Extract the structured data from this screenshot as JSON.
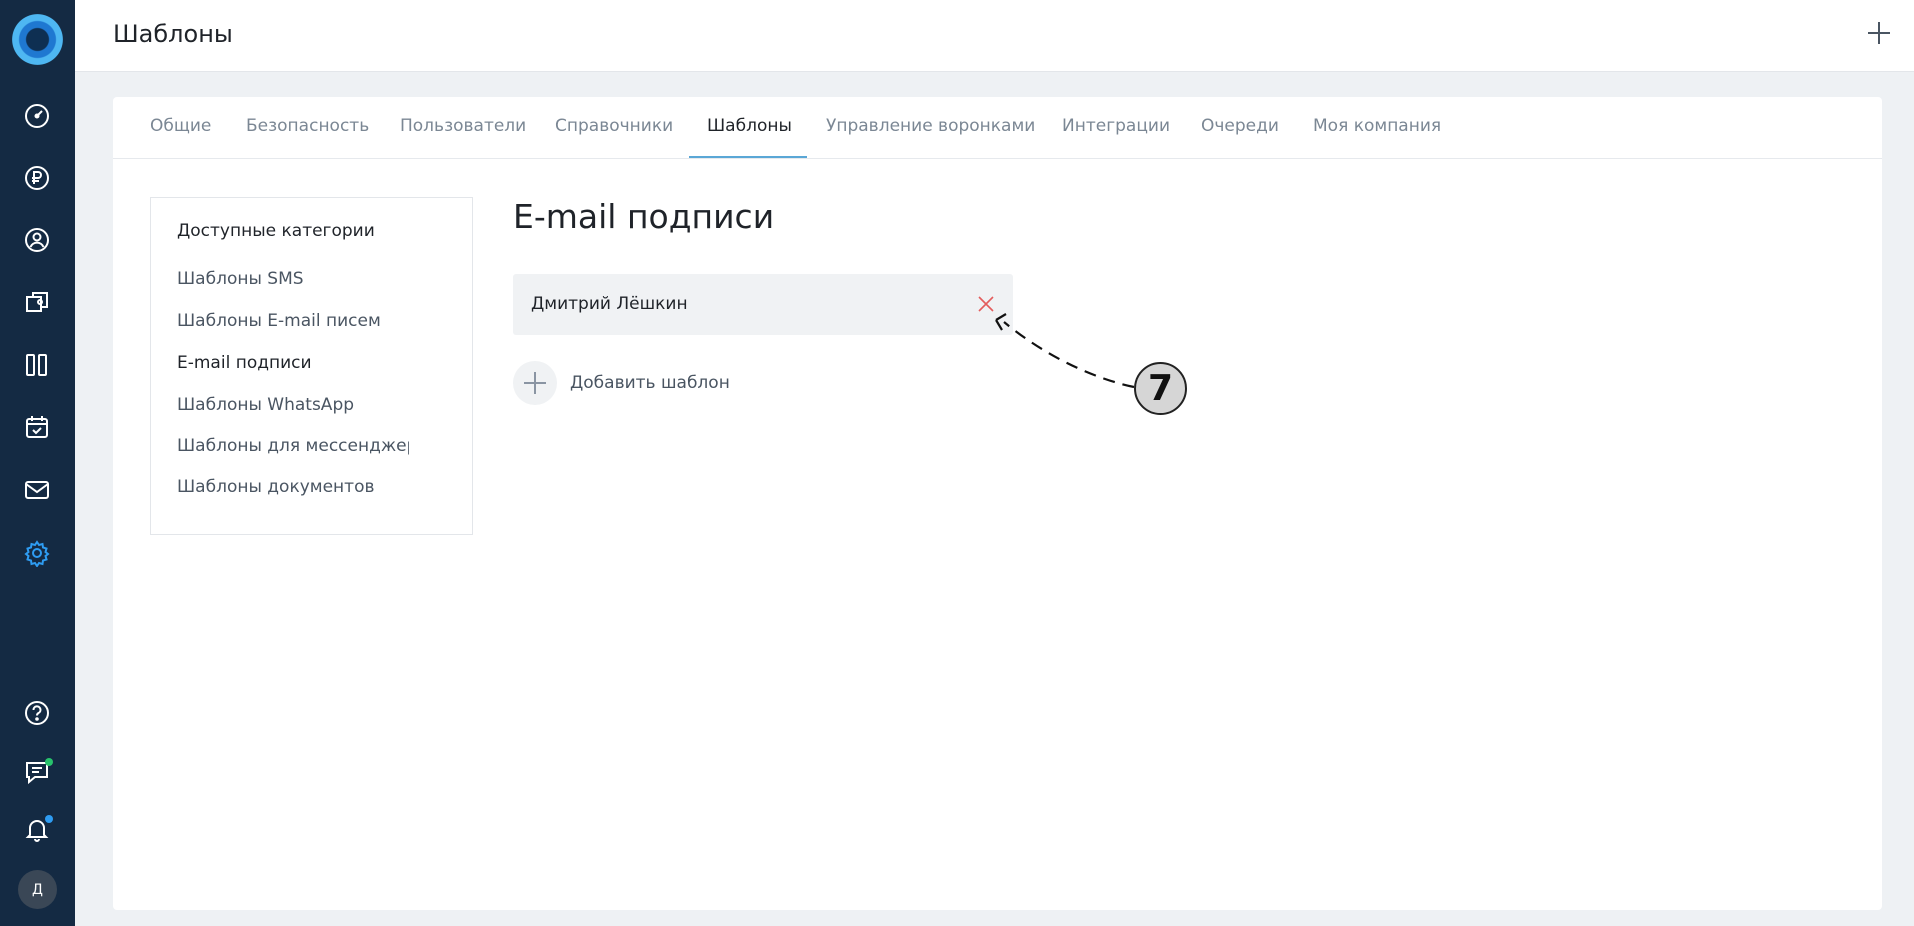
{
  "header": {
    "title": "Шаблоны",
    "add_icon": "plus-icon"
  },
  "sidebar": {
    "logo": "app-logo",
    "items": [
      {
        "icon": "dashboard-icon"
      },
      {
        "icon": "ruble-icon"
      },
      {
        "icon": "contacts-icon"
      },
      {
        "icon": "deals-icon"
      },
      {
        "icon": "kanban-icon"
      },
      {
        "icon": "calendar-icon"
      },
      {
        "icon": "mail-icon"
      },
      {
        "icon": "settings-icon",
        "active": true
      }
    ],
    "bottom": [
      {
        "icon": "help-icon"
      },
      {
        "icon": "chat-icon",
        "badge_color": "#27c26c"
      },
      {
        "icon": "bell-icon",
        "badge_color": "#2e9cf2"
      }
    ],
    "avatar_initial": "Д"
  },
  "tabs": [
    {
      "label": "Общие"
    },
    {
      "label": "Безопасность"
    },
    {
      "label": "Пользователи"
    },
    {
      "label": "Справочники"
    },
    {
      "label": "Шаблоны",
      "active": true
    },
    {
      "label": "Управление воронками"
    },
    {
      "label": "Интеграции"
    },
    {
      "label": "Очереди"
    },
    {
      "label": "Моя компания"
    }
  ],
  "categories": {
    "heading": "Доступные категории",
    "items": [
      {
        "label": "Шаблоны SMS"
      },
      {
        "label": "Шаблоны E-mail писем"
      },
      {
        "label": "E-mail подписи",
        "active": true
      },
      {
        "label": "Шаблоны WhatsApp"
      },
      {
        "label": "Шаблоны для мессенджера"
      },
      {
        "label": "Шаблоны документов"
      }
    ]
  },
  "main": {
    "title": "E-mail подписи",
    "templates": [
      {
        "name": "Дмитрий Лёшкин"
      }
    ],
    "add_label": "Добавить шаблон"
  },
  "annotation": {
    "number": "7"
  },
  "colors": {
    "sidebar_bg": "#142a43",
    "accent": "#5aa7d6",
    "settings_active": "#2e9cf2",
    "delete": "#e35d5d"
  }
}
